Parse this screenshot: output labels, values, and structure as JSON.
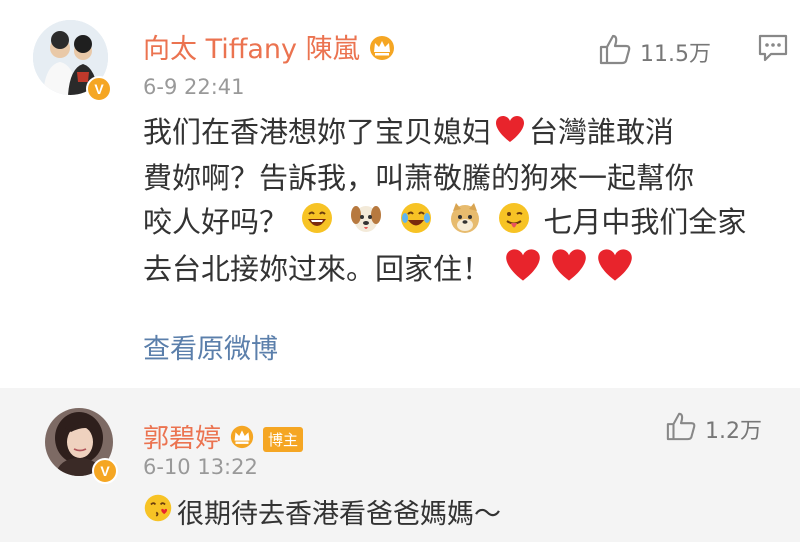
{
  "post_comment": {
    "author": "向太 Tiffany 陳嵐",
    "time": "6-9 22:41",
    "likes": "11.5万",
    "body_lines": [
      "我们在香港想妳了宝贝媳妇",
      "台灣誰敢消",
      "費妳啊？告訴我，叫萧敬騰的狗來一起幫你",
      "咬人好吗？",
      "七月中我们全家",
      "去台北接妳过來。回家住！"
    ],
    "view_original": "查看原微博"
  },
  "reply": {
    "author": "郭碧婷",
    "badge": "博主",
    "time": "6-10 13:22",
    "likes": "1.2万",
    "text": "很期待去香港看爸爸媽媽～"
  },
  "icons": {
    "verified": "V",
    "like": "thumbs-up-icon",
    "comment": "comment-icon",
    "crown": "crown-icon"
  },
  "colors": {
    "author_name": "#eb7350",
    "link": "#5b7fab",
    "timestamp": "#999999",
    "badge": "#f5a623",
    "reply_bg": "#f4f4f4"
  }
}
